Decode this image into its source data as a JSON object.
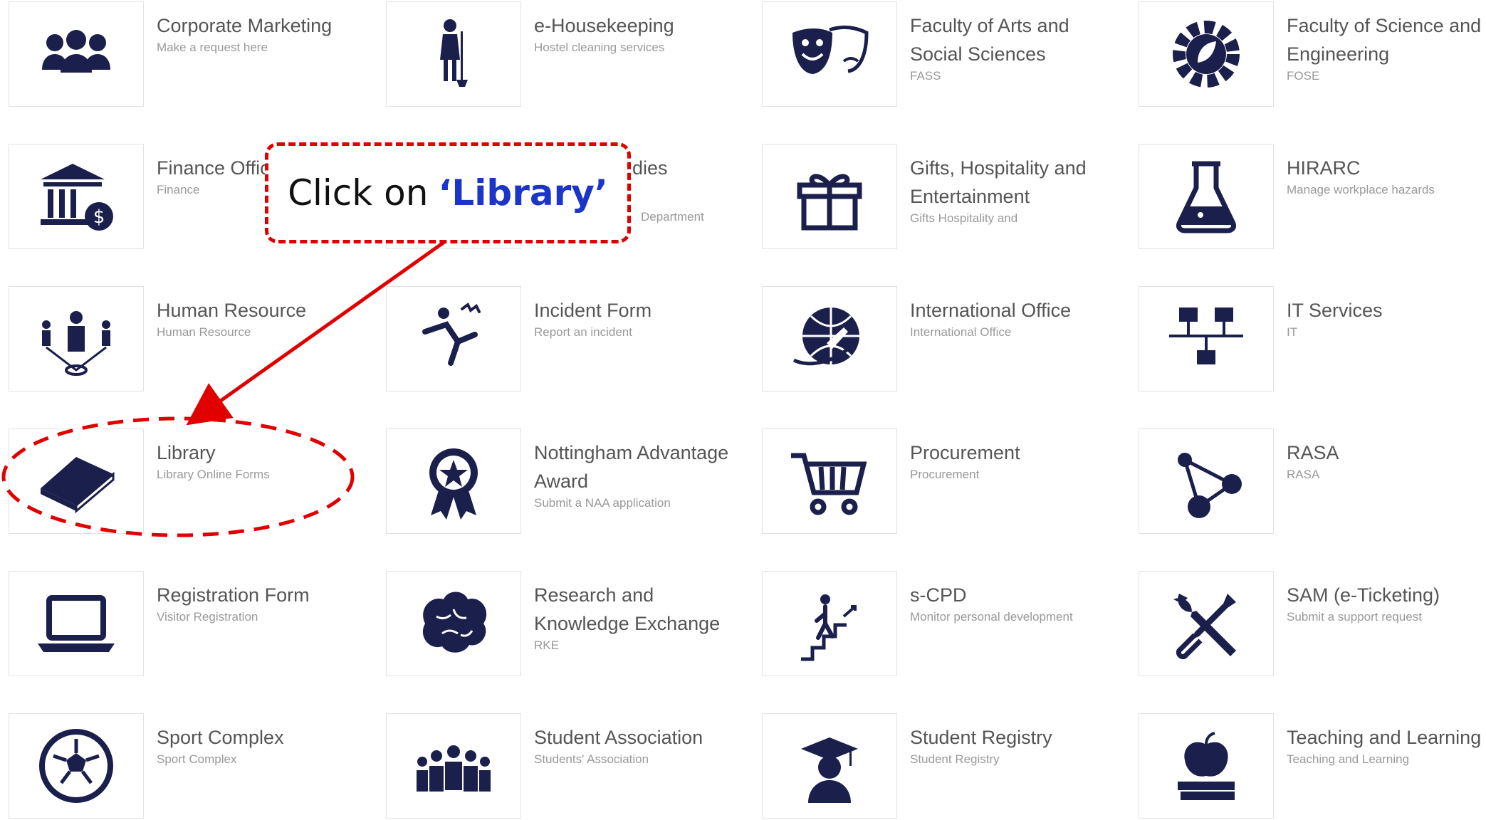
{
  "tiles": [
    {
      "title": "Corporate Marketing",
      "sub": "Make a request here",
      "icon": "people-group-icon"
    },
    {
      "title": "e-Housekeeping",
      "sub": "Hostel cleaning services",
      "icon": "housekeeper-icon"
    },
    {
      "title": "Faculty of Arts and Social Sciences",
      "sub": "FASS",
      "icon": "theater-masks-icon"
    },
    {
      "title": "Faculty of Science and Engineering",
      "sub": "FOSE",
      "icon": "gear-leaf-icon"
    },
    {
      "title": "Finance Offic",
      "sub": "Finance",
      "icon": "bank-dollar-icon"
    },
    {
      "title": "dies",
      "sub": "Department",
      "icon": "hidden-icon"
    },
    {
      "title": "Gifts, Hospitality and Entertainment",
      "sub": "Gifts Hospitality and",
      "icon": "gift-icon"
    },
    {
      "title": "HIRARC",
      "sub": "Manage workplace hazards",
      "icon": "flask-icon"
    },
    {
      "title": "Human Resource",
      "sub": "Human Resource",
      "icon": "people-network-icon"
    },
    {
      "title": "Incident Form",
      "sub": "Report an incident",
      "icon": "falling-person-icon"
    },
    {
      "title": "International Office",
      "sub": "International Office",
      "icon": "globe-plane-icon"
    },
    {
      "title": "IT Services",
      "sub": "IT",
      "icon": "network-computers-icon"
    },
    {
      "title": "Library",
      "sub": "Library Online Forms",
      "icon": "book-icon"
    },
    {
      "title": "Nottingham Advantage Award",
      "sub": "Submit a NAA application",
      "icon": "award-ribbon-icon"
    },
    {
      "title": "Procurement",
      "sub": "Procurement",
      "icon": "shopping-cart-icon"
    },
    {
      "title": "RASA",
      "sub": "RASA",
      "icon": "molecule-icon"
    },
    {
      "title": "Registration Form",
      "sub": "Visitor Registration",
      "icon": "laptop-icon"
    },
    {
      "title": "Research and Knowledge Exchange",
      "sub": "RKE",
      "icon": "brain-icon"
    },
    {
      "title": "s-CPD",
      "sub": "Monitor personal development",
      "icon": "stairs-climb-icon"
    },
    {
      "title": "SAM (e-Ticketing)",
      "sub": "Submit a support request",
      "icon": "tools-icon"
    },
    {
      "title": "Sport Complex",
      "sub": "Sport Complex",
      "icon": "soccer-ball-icon"
    },
    {
      "title": "Student Association",
      "sub": "Students' Association",
      "icon": "crowd-icon"
    },
    {
      "title": "Student Registry",
      "sub": "Student Registry",
      "icon": "graduate-icon"
    },
    {
      "title": "Teaching and Learning",
      "sub": "Teaching and Learning",
      "icon": "apple-books-icon"
    }
  ],
  "callout": {
    "prefix": "Click on",
    "highlight": "‘Library’"
  },
  "colors": {
    "icon": "#1b1f4b",
    "annotation": "#e00000",
    "highlight": "#1a35c7"
  }
}
